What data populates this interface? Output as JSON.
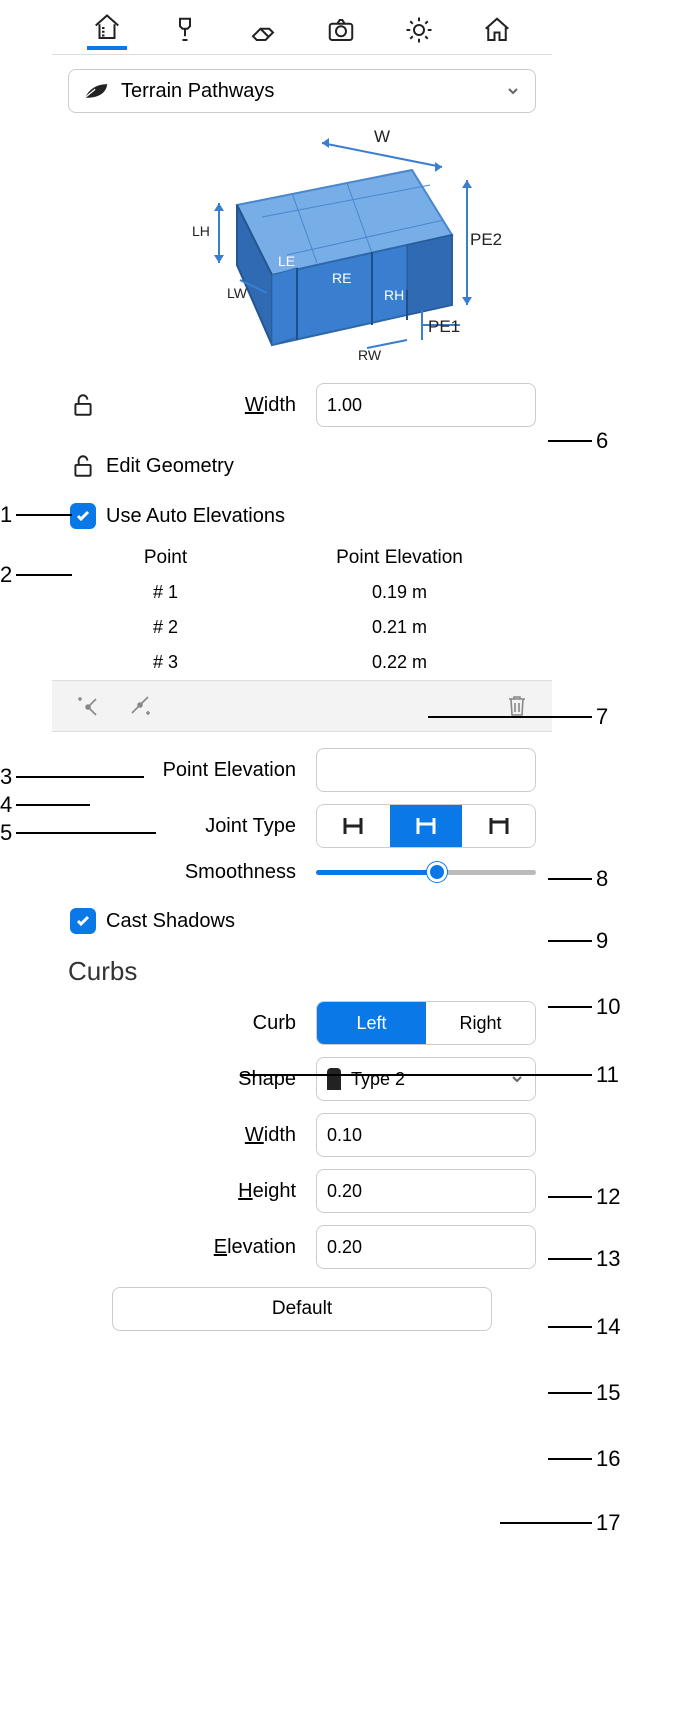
{
  "category_label": "Terrain Pathways",
  "diagram": {
    "labels": {
      "W": "W",
      "PE2": "PE2",
      "PE1": "PE1",
      "LH": "LH",
      "LE": "LE",
      "RE": "RE",
      "LW": "LW",
      "RW": "RW",
      "RH": "RH"
    }
  },
  "width": {
    "label": "Width",
    "value": "1.00"
  },
  "edit_geometry_label": "Edit Geometry",
  "use_auto_elevations_label": "Use Auto Elevations",
  "table": {
    "head_point": "Point",
    "head_elev": "Point Elevation",
    "rows": [
      {
        "point": "# 1",
        "elev": "0.19 m"
      },
      {
        "point": "# 2",
        "elev": "0.21 m"
      },
      {
        "point": "# 3",
        "elev": "0.22 m"
      }
    ]
  },
  "point_elevation_label": "Point Elevation",
  "joint_type_label": "Joint Type",
  "smoothness_label": "Smoothness",
  "cast_shadows_label": "Cast Shadows",
  "curbs_title": "Curbs",
  "curb": {
    "label": "Curb",
    "left": "Left",
    "right": "Right",
    "shape_label": "Shape",
    "shape_value": "Type 2",
    "width_label": "Width",
    "width_value": "0.10",
    "height_label": "Height",
    "height_value": "0.20",
    "elevation_label": "Elevation",
    "elevation_value": "0.20"
  },
  "default_label": "Default",
  "callouts": {
    "c1": "1",
    "c2": "2",
    "c3": "3",
    "c4": "4",
    "c5": "5",
    "c6": "6",
    "c7": "7",
    "c8": "8",
    "c9": "9",
    "c10": "10",
    "c11": "11",
    "c12": "12",
    "c13": "13",
    "c14": "14",
    "c15": "15",
    "c16": "16",
    "c17": "17"
  }
}
